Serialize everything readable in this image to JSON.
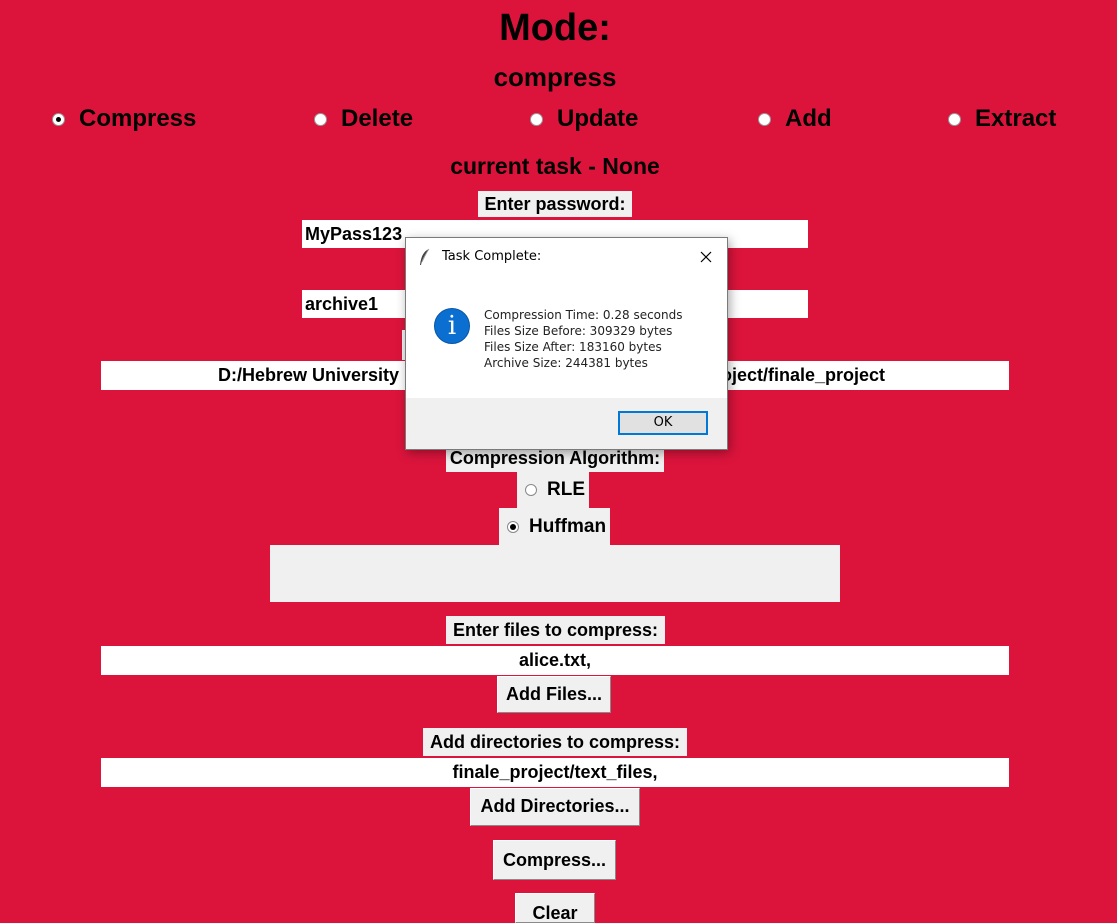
{
  "header": {
    "mode_label": "Mode:",
    "mode_value": "compress",
    "current_task": "current task - None"
  },
  "modes": [
    {
      "label": "Compress",
      "selected": true
    },
    {
      "label": "Delete",
      "selected": false
    },
    {
      "label": "Update",
      "selected": false
    },
    {
      "label": "Add",
      "selected": false
    },
    {
      "label": "Extract",
      "selected": false
    }
  ],
  "password": {
    "label": "Enter password:",
    "value": "MyPass123"
  },
  "archive_name": {
    "value": "archive1"
  },
  "output_path": {
    "visible_left": "D:/Hebrew University",
    "visible_right": "oject/finale_project"
  },
  "algorithm": {
    "label": "Compression Algorithm:",
    "options": [
      {
        "label": "RLE",
        "selected": false
      },
      {
        "label": "Huffman",
        "selected": true
      }
    ]
  },
  "files": {
    "label": "Enter files to compress:",
    "value": "alice.txt,",
    "button": "Add Files..."
  },
  "directories": {
    "label": "Add directories to compress:",
    "value": "finale_project/text_files,",
    "button": "Add Directories..."
  },
  "actions": {
    "compress": "Compress...",
    "clear": "Clear"
  },
  "dialog": {
    "title": "Task Complete:",
    "icon": "info-icon",
    "lines": [
      "Compression Time: 0.28 seconds",
      "Files Size Before: 309329 bytes",
      "Files Size After: 183160 bytes",
      "Archive Size: 244381 bytes"
    ],
    "ok": "OK"
  },
  "colors": {
    "background": "#dc143c",
    "widget_gray": "#f0f0f0",
    "info_blue": "#0a6fd0",
    "ok_border": "#0078d7"
  }
}
